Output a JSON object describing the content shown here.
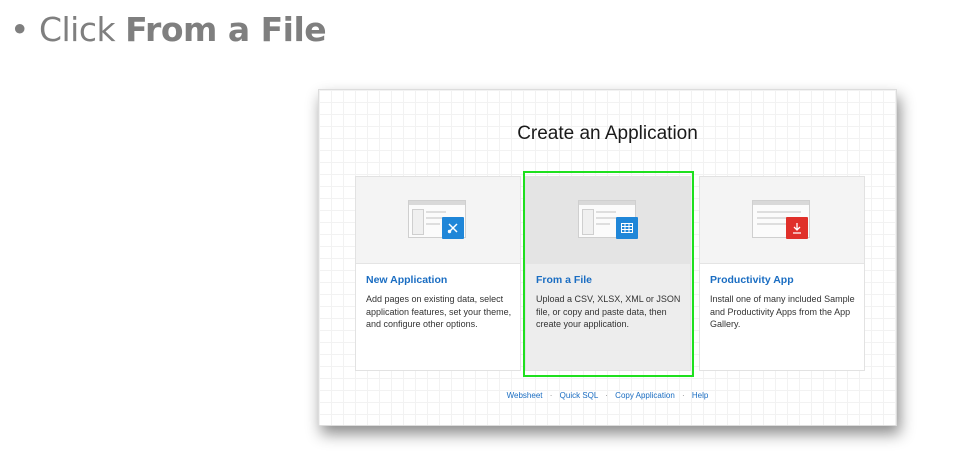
{
  "instruction": {
    "bullet": "•",
    "prefix": "Click",
    "target": "From a File"
  },
  "screen": {
    "title": "Create an Application",
    "cards": [
      {
        "title": "New Application",
        "description": "Add pages on existing data, select application features, set your theme, and configure other options.",
        "icon": "tools-icon",
        "accent": "#1f86d8"
      },
      {
        "title": "From a File",
        "description": "Upload a CSV, XLSX, XML or JSON file, or copy and paste data, then create your application.",
        "icon": "table-icon",
        "accent": "#1f86d8",
        "highlighted": true
      },
      {
        "title": "Productivity App",
        "description": "Install one of many included Sample and Productivity Apps from the App Gallery.",
        "icon": "download-icon",
        "accent": "#e0302a"
      }
    ],
    "footer_links": [
      "Websheet",
      "Quick SQL",
      "Copy Application",
      "Help"
    ],
    "footer_separator": "·"
  },
  "colors": {
    "highlight": "#1ee01e",
    "link": "#1a6dc2"
  }
}
